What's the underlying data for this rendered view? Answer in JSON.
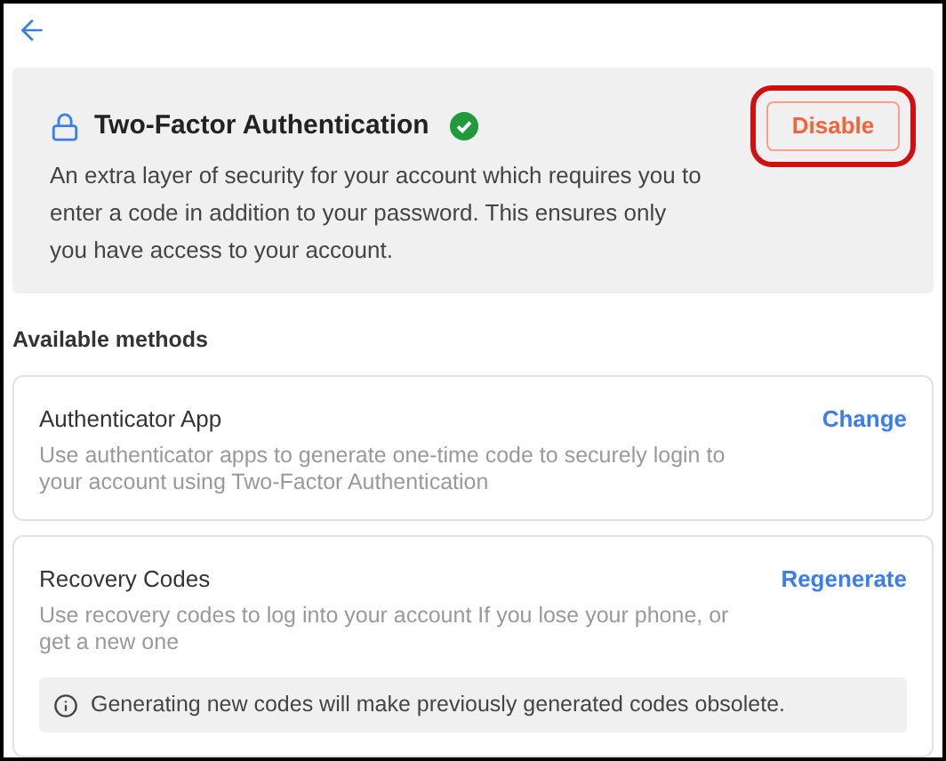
{
  "header": {
    "title": "Two-Factor Authentication",
    "enabled": true,
    "description": "An extra layer of security for your account which requires you to enter a code in addition to your password. This ensures only you have access to your account.",
    "button": "Disable",
    "highlighted": true
  },
  "section_title": "Available methods",
  "methods": [
    {
      "name": "Authenticator App",
      "description": "Use authenticator apps to generate one-time code to securely login to your account using Two-Factor Authentication",
      "action": "Change"
    },
    {
      "name": "Recovery Codes",
      "description": "Use recovery codes to log into your account If you lose your phone, or get a new one",
      "action": "Regenerate",
      "notice": "Generating new codes will make previously generated codes obsolete."
    }
  ]
}
